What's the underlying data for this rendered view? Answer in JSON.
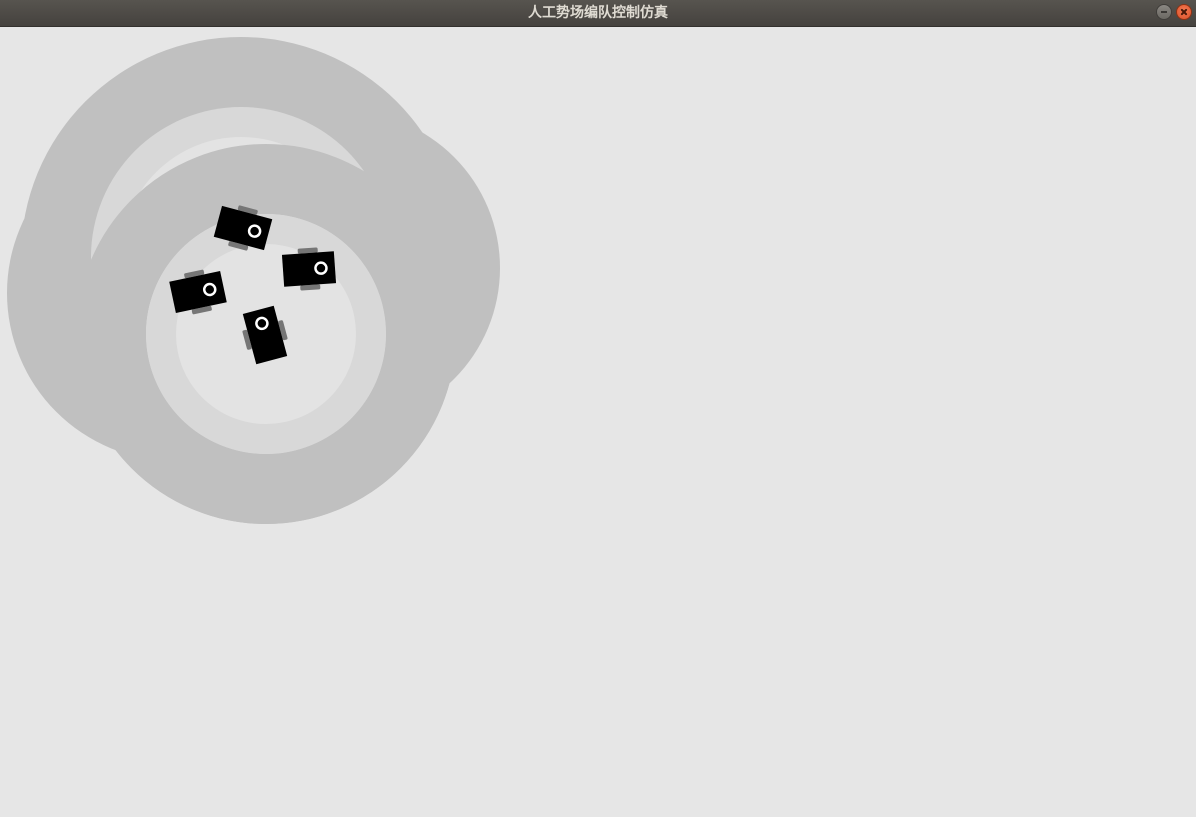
{
  "window": {
    "title": "人工势场编队控制仿真",
    "controls": {
      "minimize": "minimize-icon",
      "close": "close-icon"
    }
  },
  "scene": {
    "robots": [
      {
        "name": "robot-1",
        "heading_deg": 15
      },
      {
        "name": "robot-2",
        "heading_deg": -4
      },
      {
        "name": "robot-3",
        "heading_deg": -12
      },
      {
        "name": "robot-4",
        "heading_deg": -105
      }
    ],
    "colors": {
      "background": "#e6e6e6",
      "influence_outer": "#c0c0c0",
      "influence_mid": "#d8d8d8",
      "influence_inner": "#e3e3e3",
      "robot_body": "#000000",
      "robot_wheel": "#767676",
      "robot_marker": "#ffffff"
    }
  }
}
